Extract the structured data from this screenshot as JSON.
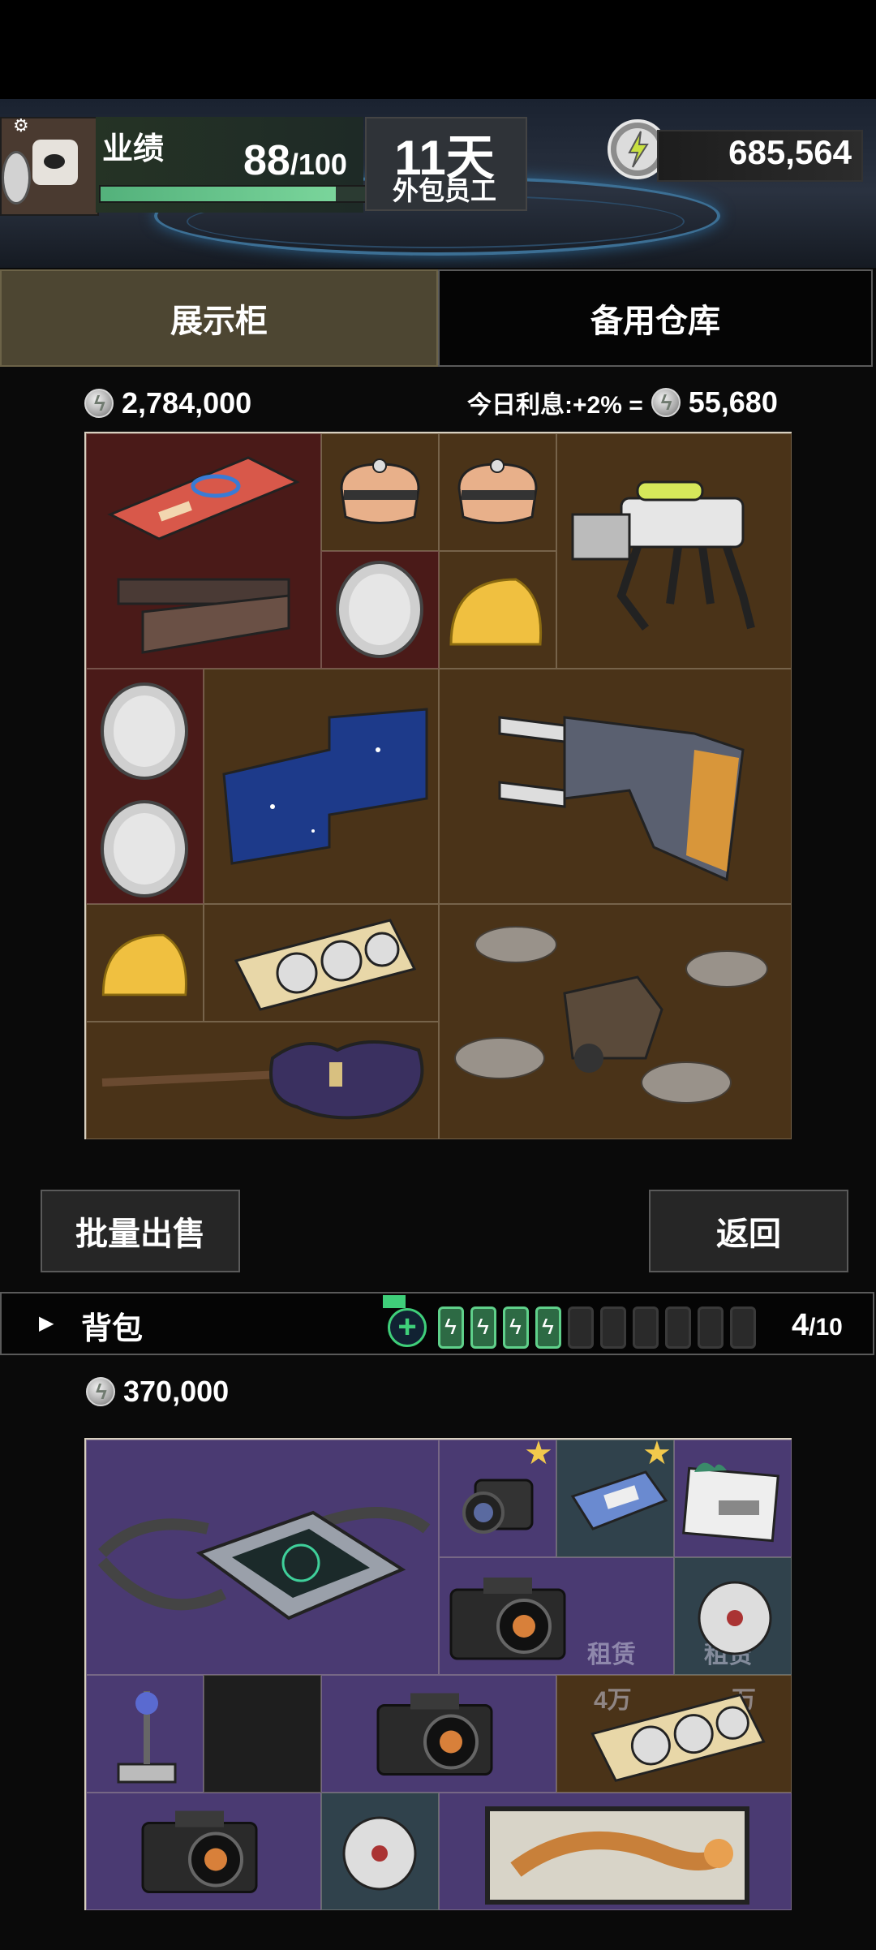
{
  "player": {
    "performance_label": "业绩",
    "performance_value": "88",
    "performance_max": "/100",
    "performance_progress": 0.88,
    "days": "11天",
    "rank": "外包员工",
    "currency": "685,564"
  },
  "tabs": [
    {
      "label": "展示柜",
      "active": true
    },
    {
      "label": "备用仓库",
      "active": false
    }
  ],
  "cabinet": {
    "value": "2,784,000",
    "interest_label": "今日利息:+2% =",
    "interest_value": "55,680",
    "items": [
      "meta-card",
      "robot-head",
      "robot-head",
      "robot-dog",
      "chocolate-bars",
      "silver-coin",
      "gold-cheese",
      "silver-coin",
      "map-tablet",
      "gloves",
      "silver-coin",
      "gold-cheese",
      "graphics-card",
      "guitar",
      "drone"
    ]
  },
  "buttons": {
    "bulk_sell": "批量出售",
    "back": "返回"
  },
  "backpack": {
    "title": "背包",
    "capacity": "4",
    "capacity_max": "/10",
    "batteries_filled": 4,
    "batteries_total": 10,
    "value": "370,000",
    "rent_label": "租赁",
    "rent_price": "4万",
    "rent_price_partial": "万",
    "items": [
      "radar-device",
      "camera-scope",
      "portable-device",
      "document",
      "camera",
      "disc",
      "sword-statue",
      "camera",
      "graphics-card",
      "camera",
      "disc",
      "tiger-painting"
    ]
  },
  "colors": {
    "accent_green": "#53b17b",
    "cabinet_bg": "#4a3318",
    "backpack_bg": "#4a3a72",
    "star": "#f2c94c"
  }
}
